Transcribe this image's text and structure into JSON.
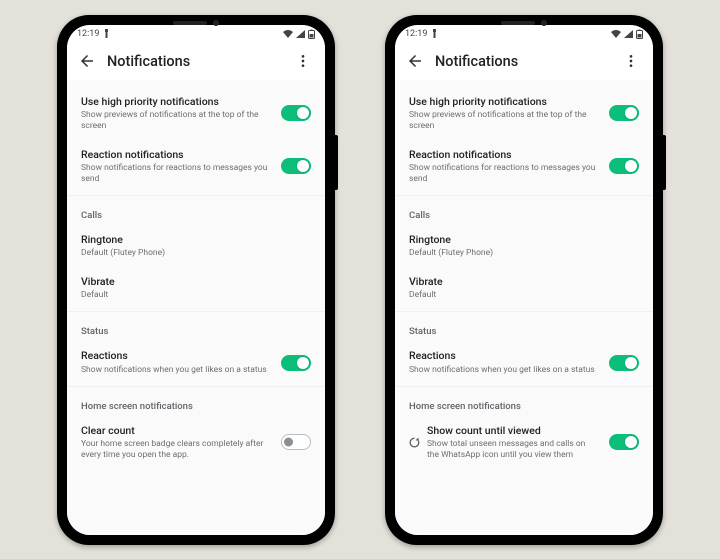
{
  "status": {
    "time": "12:19"
  },
  "appbar": {
    "title": "Notifications"
  },
  "remnant": "",
  "items": {
    "hp": {
      "title": "Use high priority notifications",
      "sub": "Show previews of notifications at the top of the screen"
    },
    "rn": {
      "title": "Reaction notifications",
      "sub": "Show notifications for reactions to messages you send"
    }
  },
  "calls": {
    "header": "Calls",
    "ringtone": {
      "title": "Ringtone",
      "sub": "Default (Flutey Phone)"
    },
    "vibrate": {
      "title": "Vibrate",
      "sub": "Default"
    }
  },
  "statusSec": {
    "header": "Status",
    "reactions": {
      "title": "Reactions",
      "sub": "Show notifications when you get likes on a status"
    }
  },
  "home": {
    "header": "Home screen notifications",
    "clear": {
      "title": "Clear count",
      "sub": "Your home screen badge clears completely after every time you open the app."
    },
    "show": {
      "title": "Show count until viewed",
      "sub": "Show total unseen messages and calls on the WhatsApp icon until you view them"
    }
  }
}
